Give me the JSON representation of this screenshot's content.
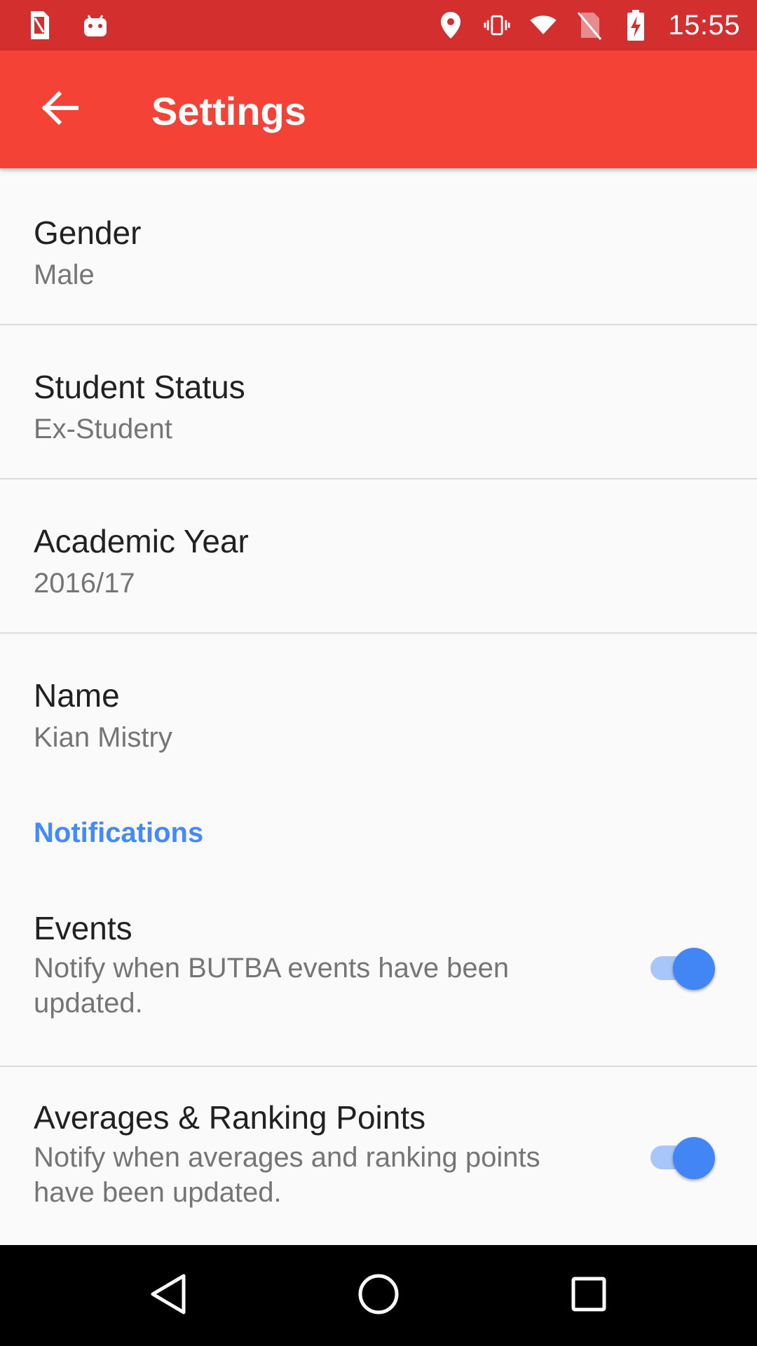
{
  "status_bar": {
    "time": "15:55",
    "icons_left": [
      "sim-card-icon",
      "android-icon"
    ],
    "icons_right": [
      "location-icon",
      "vibrate-icon",
      "wifi-icon",
      "no-sim-icon",
      "battery-charging-icon"
    ]
  },
  "appbar": {
    "title": "Settings",
    "back_icon": "arrow-back-icon",
    "color": "#f44336"
  },
  "preferences": [
    {
      "title": "Gender",
      "summary": "Male"
    },
    {
      "title": "Student Status",
      "summary": "Ex-Student"
    },
    {
      "title": "Academic Year",
      "summary": "2016/17"
    },
    {
      "title": "Name",
      "summary": "Kian Mistry"
    }
  ],
  "notifications": {
    "category_title": "Notifications",
    "accent": "#448aff",
    "items": [
      {
        "title": "Events",
        "summary": "Notify when BUTBA events have been updated.",
        "enabled": true
      },
      {
        "title": "Averages & Ranking Points",
        "summary": "Notify when averages and ranking points have been updated.",
        "enabled": true
      }
    ]
  },
  "nav_bar": {
    "buttons": [
      "back-triangle-icon",
      "home-circle-icon",
      "recents-square-icon"
    ]
  }
}
